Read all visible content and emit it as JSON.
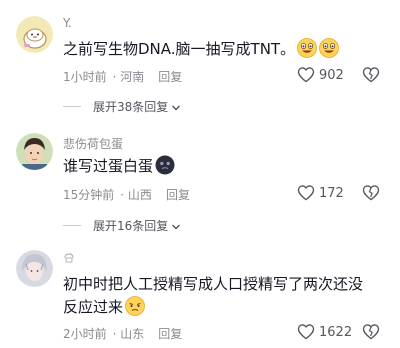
{
  "comments": [
    {
      "username": "Y.",
      "text": "之前写生物DNA.脑一抽写成TNT。",
      "emoji": [
        "grinning-face-icon",
        "grinning-face-icon"
      ],
      "time": "1小时前",
      "location": "河南",
      "reply_label": "回复",
      "likes": "902",
      "expand_label": "展开38条回复"
    },
    {
      "username": "悲伤荷包蛋",
      "text": "谁写过蛋白蛋",
      "emoji": [
        "dark-face-icon"
      ],
      "time": "15分钟前",
      "location": "山西",
      "reply_label": "回复",
      "likes": "172",
      "expand_label": "展开16条回复"
    },
    {
      "username": "",
      "text": "初中时把人工授精写成人口授精写了两次还没反应过来",
      "emoji": [
        "awkward-face-icon"
      ],
      "time": "2小时前",
      "location": "山东",
      "reply_label": "回复",
      "likes": "1622"
    }
  ]
}
